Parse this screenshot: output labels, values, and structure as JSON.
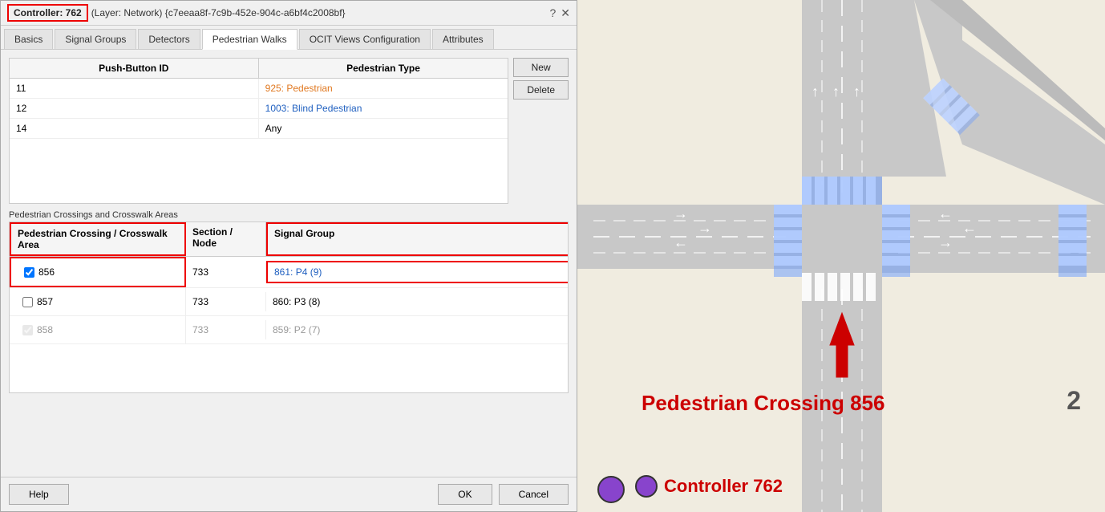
{
  "titleBar": {
    "controllerLabel": "Controller: 762",
    "subtitleText": "(Layer: Network) {c7eeaa8f-7c9b-452e-904c-a6bf4c2008bf}",
    "helpIcon": "?",
    "closeIcon": "✕"
  },
  "tabs": [
    {
      "id": "basics",
      "label": "Basics",
      "active": false
    },
    {
      "id": "signal-groups",
      "label": "Signal Groups",
      "active": false
    },
    {
      "id": "detectors",
      "label": "Detectors",
      "active": false
    },
    {
      "id": "pedestrian-walks",
      "label": "Pedestrian Walks",
      "active": true
    },
    {
      "id": "ocit-views",
      "label": "OCIT Views Configuration",
      "active": false
    },
    {
      "id": "attributes",
      "label": "Attributes",
      "active": false
    }
  ],
  "pushButtonTable": {
    "col1Header": "Push-Button ID",
    "col2Header": "Pedestrian Type",
    "rows": [
      {
        "id": "11",
        "type": "925: Pedestrian",
        "typeClass": "link-orange"
      },
      {
        "id": "12",
        "type": "1003: Blind Pedestrian",
        "typeClass": "link-blue"
      },
      {
        "id": "14",
        "type": "Any",
        "typeClass": ""
      }
    ],
    "newButtonLabel": "New",
    "deleteButtonLabel": "Delete"
  },
  "crossingsSection": {
    "sectionLabel": "Pedestrian Crossings and Crosswalk Areas",
    "col1Header": "Pedestrian Crossing / Crosswalk Area",
    "col2Header": "Section / Node",
    "col3Header": "Signal Group",
    "rows": [
      {
        "id": "856",
        "checked": true,
        "indeterminate": false,
        "grayed": false,
        "section": "733",
        "signalGroup": "861: P4 (9)",
        "sgClass": "link-blue",
        "highlighted": true
      },
      {
        "id": "857",
        "checked": false,
        "indeterminate": false,
        "grayed": false,
        "section": "733",
        "signalGroup": "860: P3 (8)",
        "sgClass": "",
        "highlighted": false
      },
      {
        "id": "858",
        "checked": true,
        "indeterminate": false,
        "grayed": true,
        "section": "733",
        "signalGroup": "859: P2 (7)",
        "sgClass": "",
        "highlighted": false
      }
    ]
  },
  "footer": {
    "helpLabel": "Help",
    "okLabel": "OK",
    "cancelLabel": "Cancel"
  },
  "map": {
    "pedestrianAnnotation": "Pedestrian Crossing 856",
    "controllerAnnotation": "Controller 762",
    "numberLabel": "2"
  }
}
